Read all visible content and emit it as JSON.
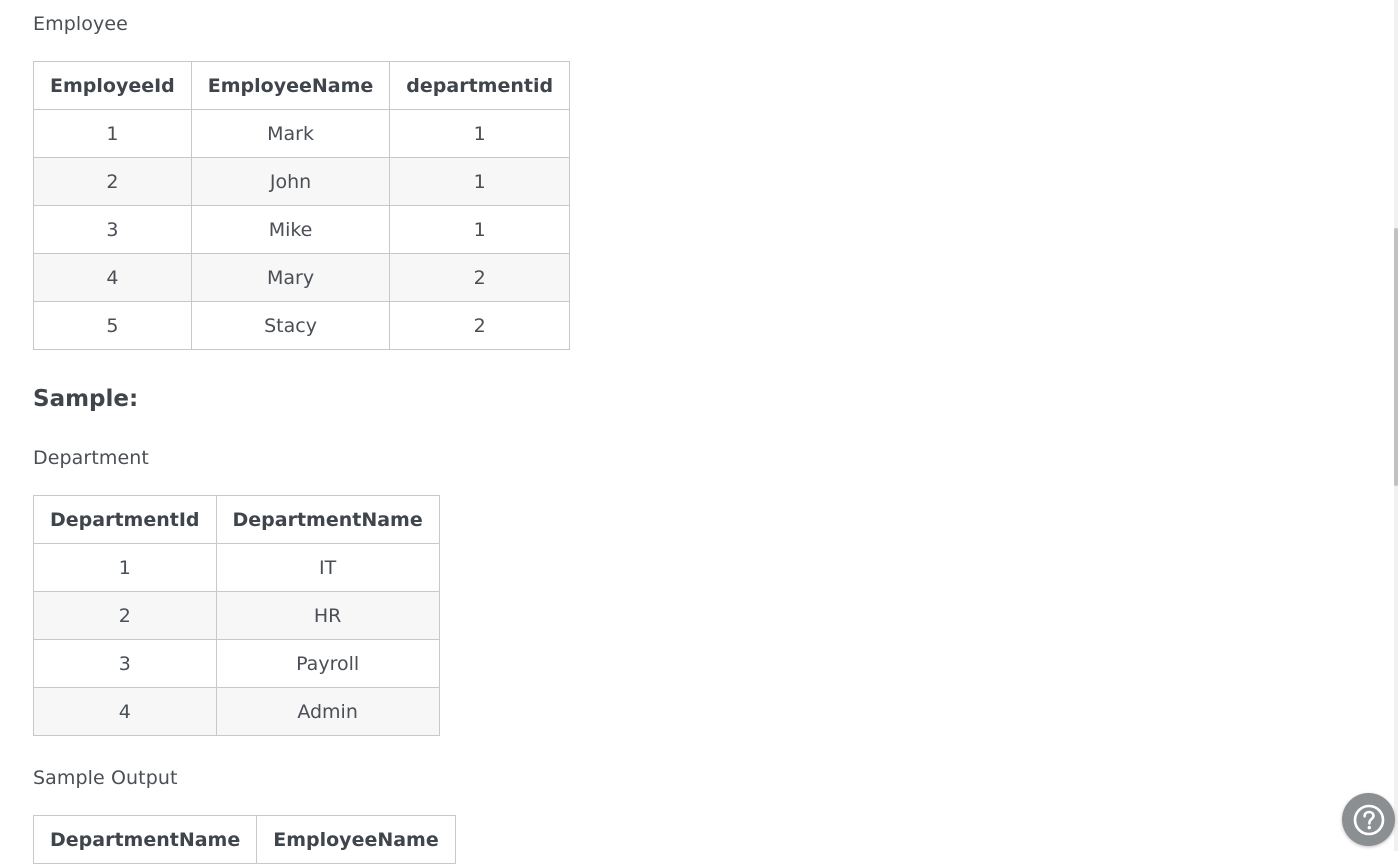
{
  "employee_section": {
    "caption": "Employee",
    "columns": [
      "EmployeeId",
      "EmployeeName",
      "departmentid"
    ],
    "rows": [
      [
        "1",
        "Mark",
        "1"
      ],
      [
        "2",
        "John",
        "1"
      ],
      [
        "3",
        "Mike",
        "1"
      ],
      [
        "4",
        "Mary",
        "2"
      ],
      [
        "5",
        "Stacy",
        "2"
      ]
    ]
  },
  "sample_heading": "Sample:",
  "department_section": {
    "caption": "Department",
    "columns": [
      "DepartmentId",
      "DepartmentName"
    ],
    "rows": [
      [
        "1",
        "IT"
      ],
      [
        "2",
        "HR"
      ],
      [
        "3",
        "Payroll"
      ],
      [
        "4",
        "Admin"
      ]
    ]
  },
  "output_section": {
    "caption": "Sample Output",
    "columns": [
      "DepartmentName",
      "EmployeeName"
    ]
  },
  "help_button": {
    "icon": "help-circle-icon",
    "color": "#8c8f92"
  }
}
